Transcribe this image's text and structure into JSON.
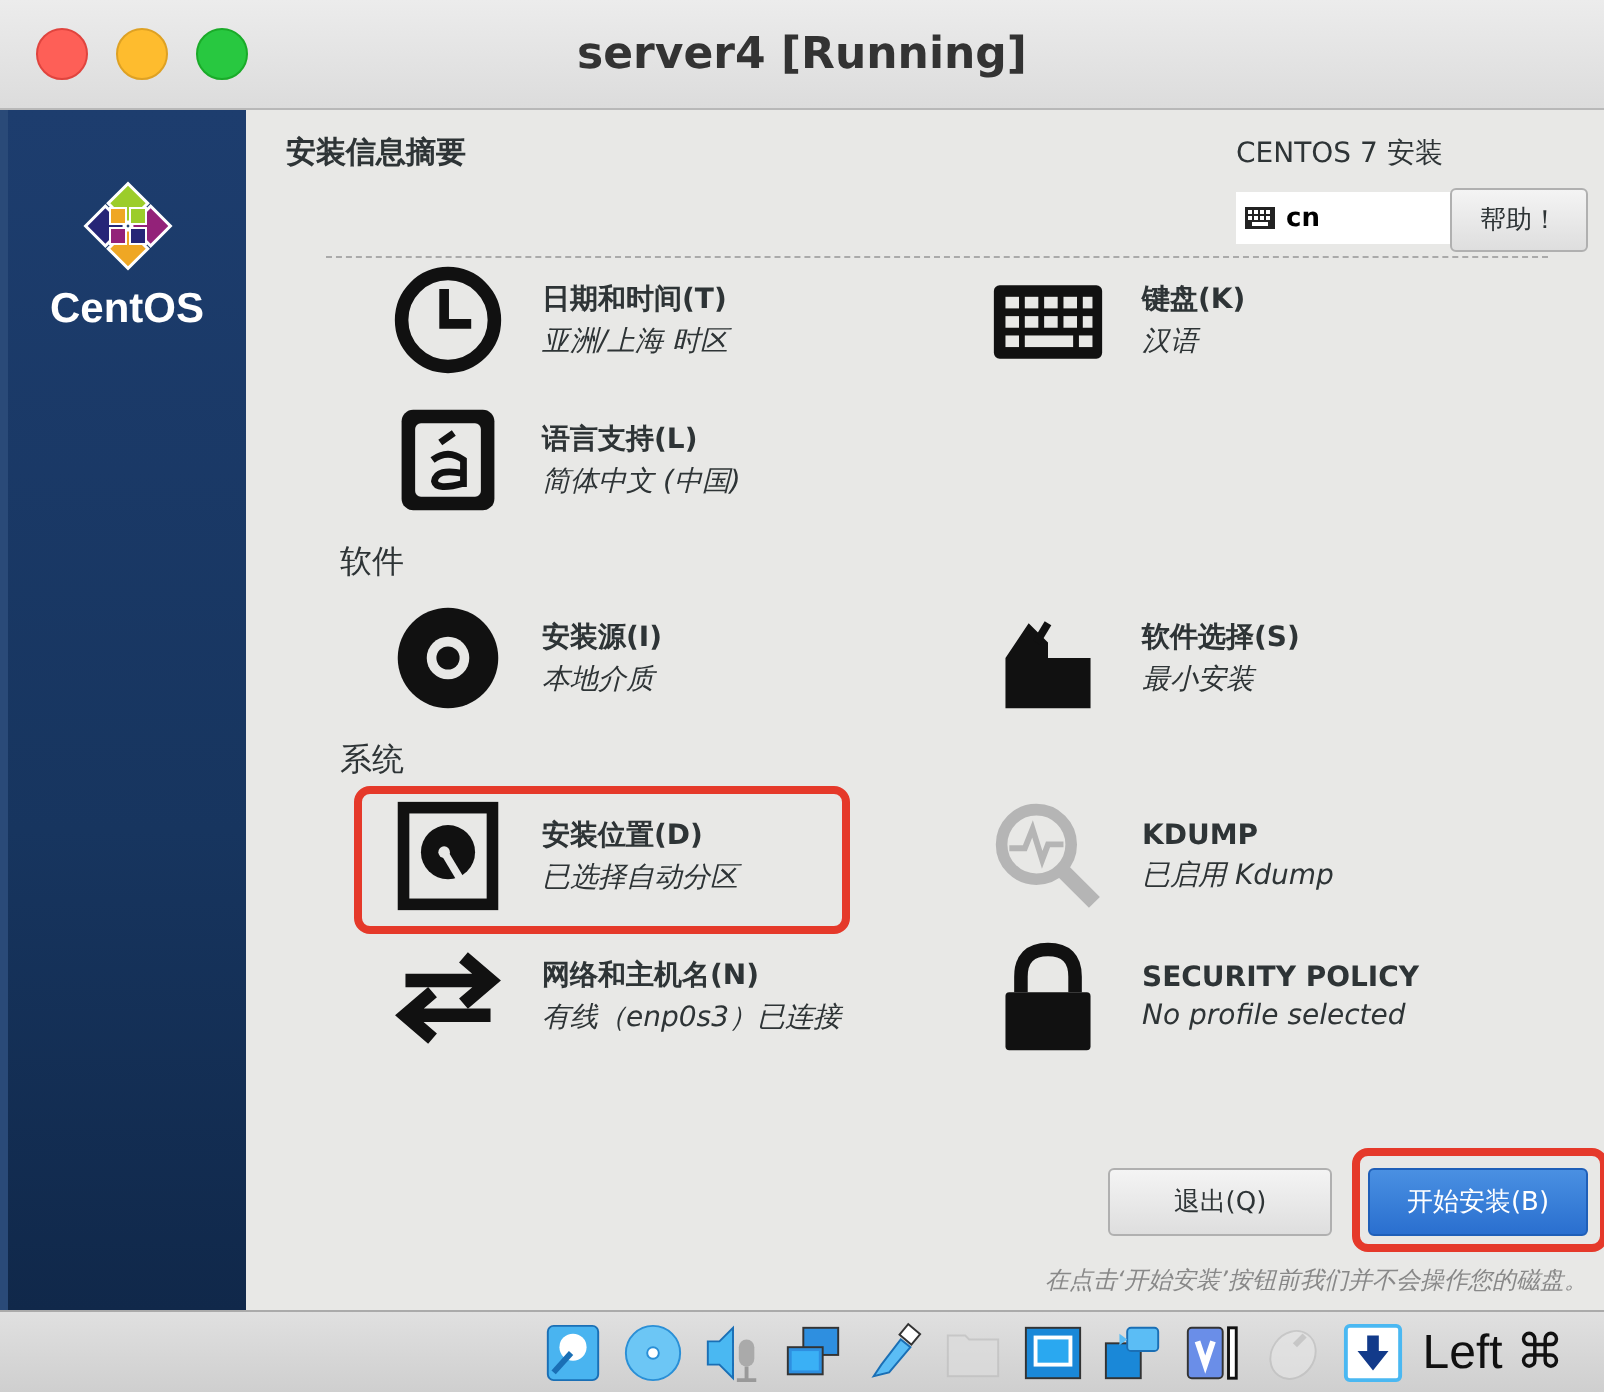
{
  "window": {
    "title": "server4 [Running]"
  },
  "sidebar": {
    "logo_text": "CentOS"
  },
  "header": {
    "title": "安装信息摘要",
    "product": "CENTOS 7 安装",
    "keyboard_layout": "cn",
    "help_button": "帮助！"
  },
  "sections": [
    {
      "items": [
        {
          "kind": "clock",
          "title": "日期和时间(T)",
          "status": "亚洲/上海 时区",
          "highlighted": false
        },
        {
          "kind": "keyboard",
          "title": "键盘(K)",
          "status": "汉语",
          "highlighted": false
        },
        {
          "kind": "language",
          "title": "语言支持(L)",
          "status": "简体中文 (中国)",
          "highlighted": false
        }
      ]
    },
    {
      "heading": "软件",
      "items": [
        {
          "kind": "disc",
          "title": "安装源(I)",
          "status": "本地介质",
          "highlighted": false
        },
        {
          "kind": "package",
          "title": "软件选择(S)",
          "status": "最小安装",
          "highlighted": false
        }
      ]
    },
    {
      "heading": "系统",
      "items": [
        {
          "kind": "disk",
          "title": "安装位置(D)",
          "status": "已选择自动分区",
          "highlighted": true
        },
        {
          "kind": "kdump",
          "title": "KDUMP",
          "status": "已启用 Kdump",
          "highlighted": false
        },
        {
          "kind": "network",
          "title": "网络和主机名(N)",
          "status": "有线（enp0s3）已连接",
          "highlighted": false
        },
        {
          "kind": "lock",
          "title": "SECURITY POLICY",
          "status": "No profile selected",
          "highlighted": false
        }
      ]
    }
  ],
  "footer": {
    "quit_button": "退出(Q)",
    "begin_button": "开始安装(B)",
    "begin_highlighted": true,
    "note": "在点击‘开始安装’按钮前我们并不会操作您的磁盘。"
  },
  "status_bar": {
    "icons": [
      {
        "kind": "hard-disk",
        "disabled": false
      },
      {
        "kind": "disc",
        "disabled": false
      },
      {
        "kind": "audio",
        "disabled": false
      },
      {
        "kind": "network",
        "disabled": false
      },
      {
        "kind": "usb",
        "disabled": false
      },
      {
        "kind": "folder",
        "disabled": true
      },
      {
        "kind": "display",
        "disabled": false
      },
      {
        "kind": "capture",
        "disabled": false
      },
      {
        "kind": "chip",
        "disabled": false
      },
      {
        "kind": "mouse",
        "disabled": true
      },
      {
        "kind": "download",
        "disabled": false
      }
    ],
    "host_key": "Left ⌘"
  }
}
